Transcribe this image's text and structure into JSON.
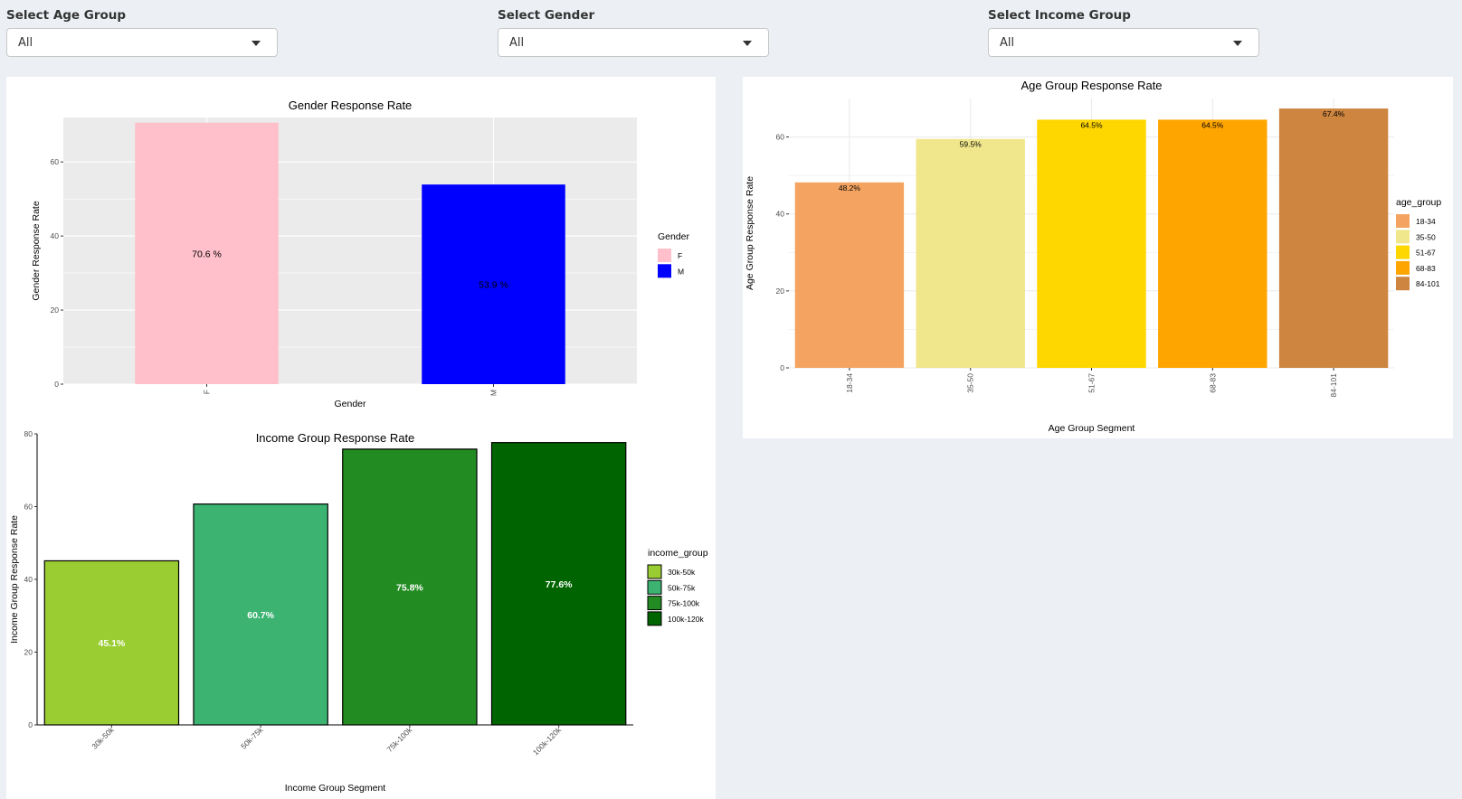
{
  "filters": [
    {
      "label": "Select Age Group",
      "value": "All"
    },
    {
      "label": "Select Gender",
      "value": "All"
    },
    {
      "label": "Select Income Group",
      "value": "All"
    }
  ],
  "chart_data": [
    {
      "id": "gender",
      "type": "bar",
      "title": "Gender Response Rate",
      "xlabel": "Gender",
      "ylabel": "Gender Response Rate",
      "categories": [
        "F",
        "M"
      ],
      "values": [
        70.6,
        53.9
      ],
      "labels": [
        "70.6 %",
        "53.9 %"
      ],
      "colors": [
        "#ffc0cb",
        "#0000ff"
      ],
      "legend_title": "Gender",
      "legend": [
        "F",
        "M"
      ],
      "legend_position": "right",
      "ylim": [
        0,
        72
      ],
      "yticks": [
        0,
        20,
        40,
        60
      ],
      "grid": true,
      "background": "#ebebeb"
    },
    {
      "id": "age",
      "type": "bar",
      "title": "Age Group Response Rate",
      "xlabel": "Age Group Segment",
      "ylabel": "Age Group Response Rate",
      "categories": [
        "18-34",
        "35-50",
        "51-67",
        "68-83",
        "84-101"
      ],
      "values": [
        48.2,
        59.5,
        64.5,
        64.5,
        67.4
      ],
      "labels": [
        "48.2%",
        "59.5%",
        "64.5%",
        "64.5%",
        "67.4%"
      ],
      "colors": [
        "#f4a460",
        "#f0e68c",
        "#ffd700",
        "#ffa500",
        "#cd853f"
      ],
      "legend_title": "age_group",
      "legend": [
        "18-34",
        "35-50",
        "51-67",
        "68-83",
        "84-101"
      ],
      "legend_position": "right",
      "ylim": [
        0,
        70
      ],
      "yticks": [
        0,
        20,
        40,
        60
      ],
      "grid": true,
      "background": "#ffffff"
    },
    {
      "id": "income",
      "type": "bar",
      "title": "Income Group Response Rate",
      "xlabel": "Income Group Segment",
      "ylabel": "Income Group Response Rate",
      "categories": [
        "30k-50k",
        "50k-75k",
        "75k-100k",
        "100k-120k"
      ],
      "values": [
        45.1,
        60.7,
        75.8,
        77.6
      ],
      "labels": [
        "45.1%",
        "60.7%",
        "75.8%",
        "77.6%"
      ],
      "colors": [
        "#9acd32",
        "#3cb371",
        "#228b22",
        "#006400"
      ],
      "legend_title": "income_group",
      "legend": [
        "30k-50k",
        "50k-75k",
        "75k-100k",
        "100k-120k"
      ],
      "legend_position": "right",
      "ylim": [
        0,
        80
      ],
      "yticks": [
        0,
        20,
        40,
        60,
        80
      ],
      "grid": false,
      "background": "#ffffff"
    }
  ]
}
